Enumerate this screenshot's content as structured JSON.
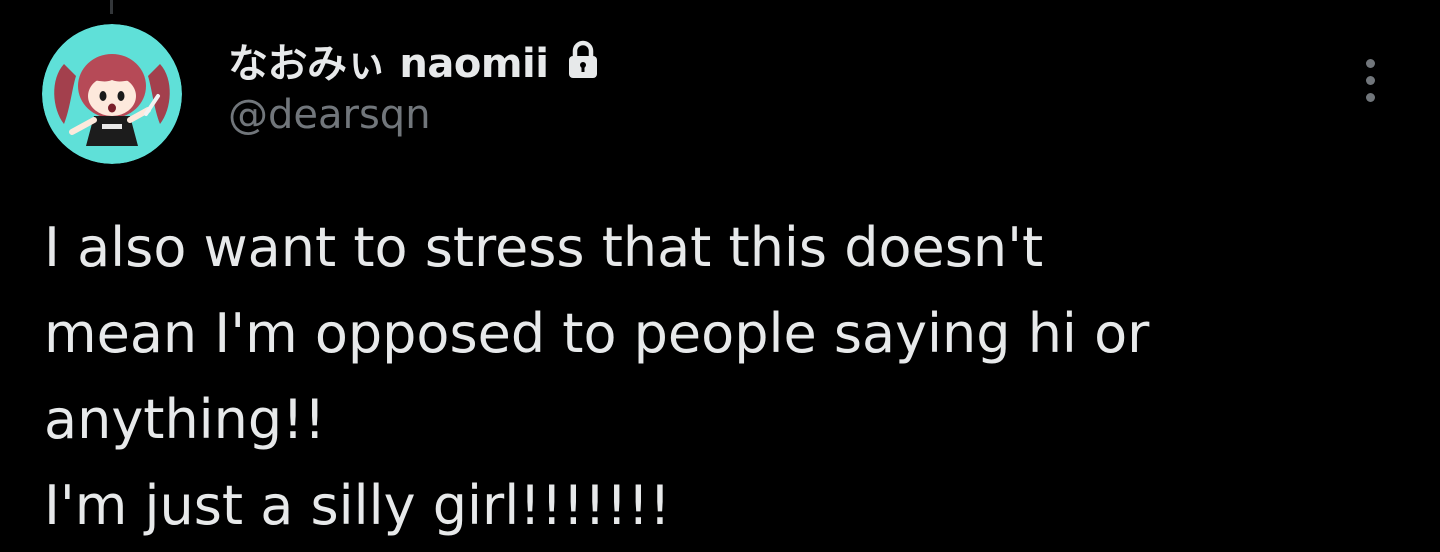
{
  "tweet": {
    "author": {
      "display_name": "なおみぃ naomii",
      "handle": "@dearsqn",
      "protected_icon": "lock-icon",
      "avatar_background": "#5fe0d8"
    },
    "text_lines": [
      "I also want to stress that this doesn't",
      "mean I'm opposed to people saying hi or",
      "anything!!",
      "I'm just a silly girl!!!!!!!"
    ],
    "more_icon": "more-vertical-icon"
  },
  "theme": {
    "background": "#000000",
    "text_primary": "#e7e9ea",
    "text_secondary": "#71767b"
  }
}
